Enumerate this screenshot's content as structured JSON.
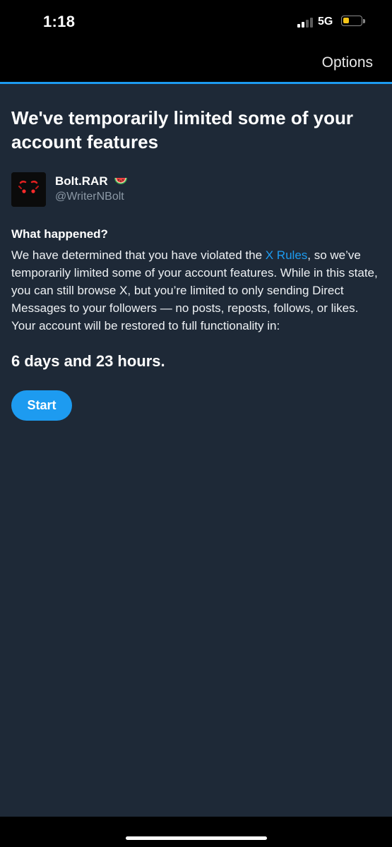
{
  "status_bar": {
    "time": "1:18",
    "network": "5G",
    "battery_level": 0.35,
    "battery_color": "#f5c518"
  },
  "header": {
    "options_label": "Options",
    "accent_color": "#1d9bf0"
  },
  "notice": {
    "title": "We've temporarily limited some of your account features",
    "user": {
      "display_name": "Bolt.RAR",
      "handle": "@WriterNBolt",
      "name_emoji_icon": "watermelon-icon",
      "avatar_icon": "dark-avatar-icon"
    },
    "section_heading": "What happened?",
    "body_before_link": "We have determined that you have violated the ",
    "link_text": "X Rules",
    "body_after_link": ", so we’ve temporarily limited some of your account features. While in this state, you can still browse X, but you’re limited to only sending Direct Messages to your followers — no posts, reposts, follows, or likes. Your account will be restored to full functionality in:",
    "time_remaining": "6 days and 23 hours.",
    "start_button_label": "Start"
  },
  "colors": {
    "background": "#1e2937",
    "bar_background": "#000000",
    "link": "#1d9bf0",
    "secondary_text": "#8b98a5"
  }
}
